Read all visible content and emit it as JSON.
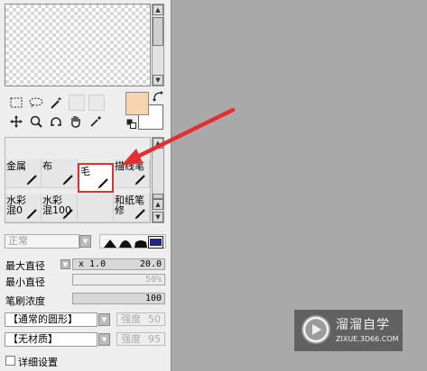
{
  "brush_grid": {
    "cells": [
      {
        "label": "金属",
        "selected": false
      },
      {
        "label": "布",
        "selected": false
      },
      {
        "label": "毛",
        "selected": true
      },
      {
        "label": "描线笔",
        "selected": false
      },
      {
        "label": "水彩\n混0",
        "selected": false
      },
      {
        "label": "水彩\n混100",
        "selected": false
      },
      {
        "label": "",
        "selected": false
      },
      {
        "label": "和纸笔\n修",
        "selected": false
      }
    ]
  },
  "mode": {
    "blend": "正常"
  },
  "max_size": {
    "label": "最大直径",
    "multiplier": "x 1.0",
    "value": "20.0"
  },
  "min_size": {
    "label": "最小直径",
    "value": "50%"
  },
  "density": {
    "label": "笔刷浓度",
    "value": "100"
  },
  "shape1": {
    "value": "【通常的圆形】",
    "strength_label": "强度",
    "strength": "50"
  },
  "shape2": {
    "value": "【无材质】",
    "strength_label": "强度",
    "strength": "95"
  },
  "advanced": {
    "label": "详细设置"
  },
  "watermark": {
    "title": "溜溜自学",
    "url": "ZIXUE.3D66.COM"
  },
  "colors": {
    "primary": "#f7d4b0",
    "secondary": "#ffffff",
    "annotation": "#e23030"
  }
}
